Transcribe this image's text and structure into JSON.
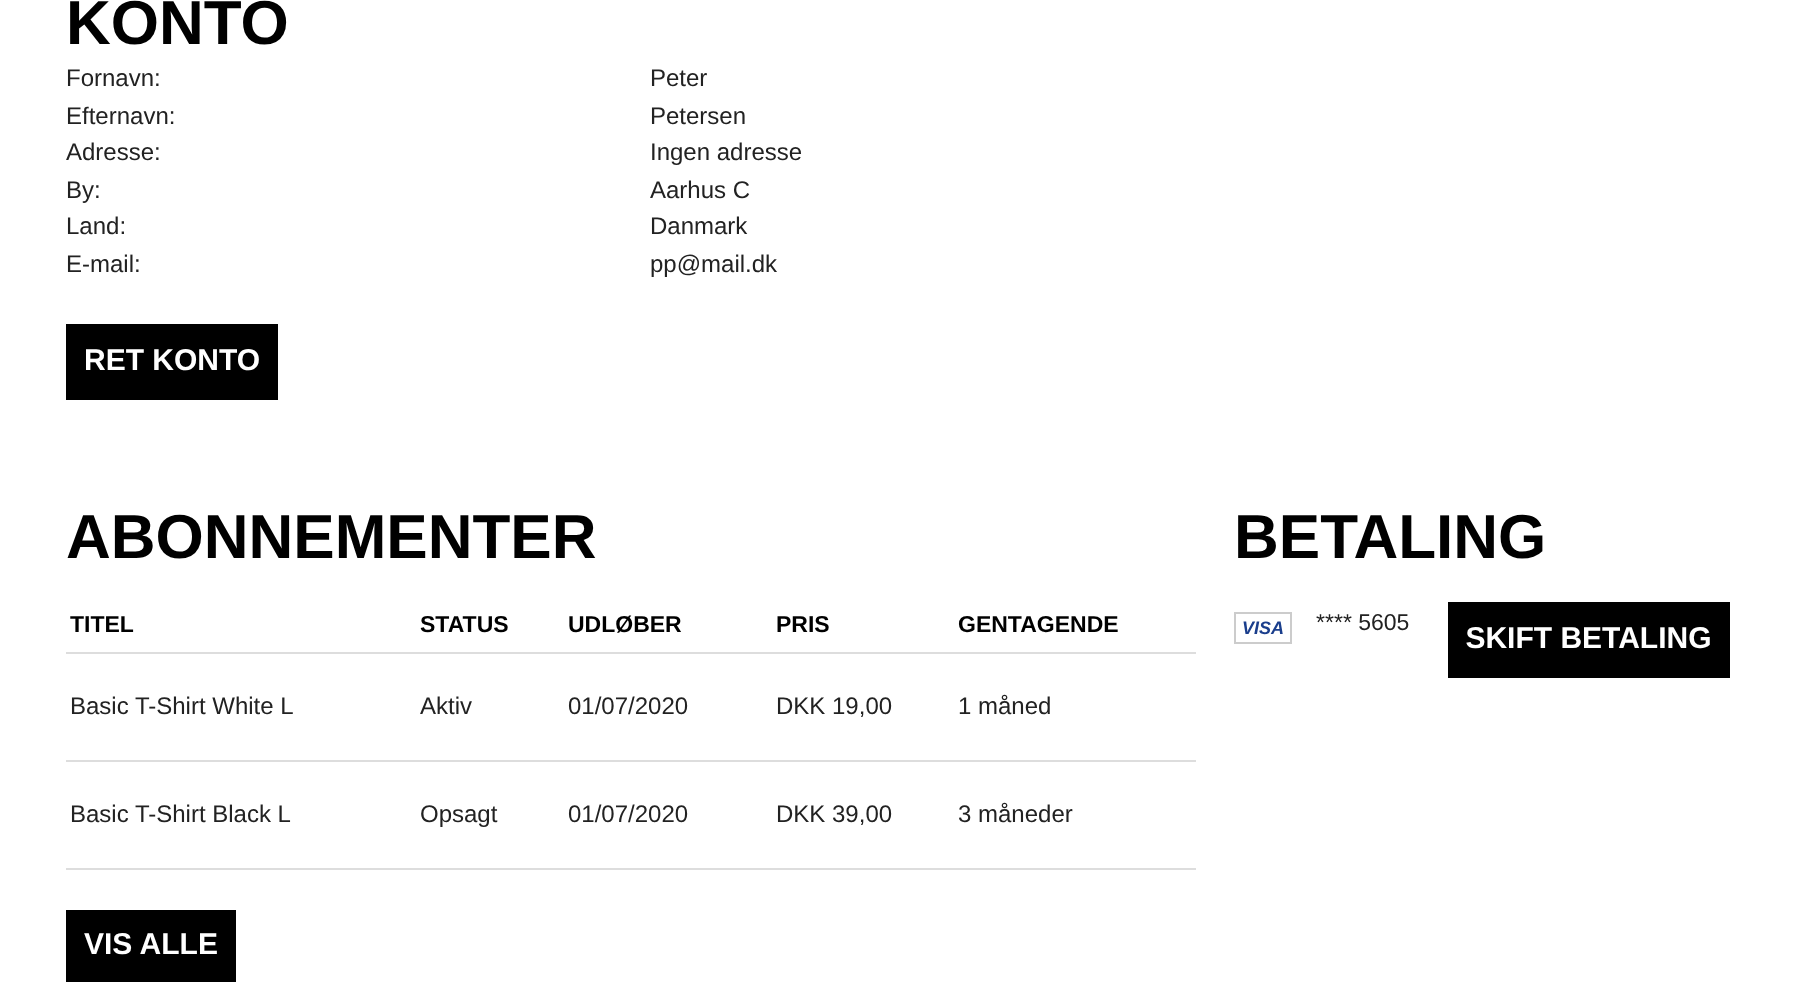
{
  "account": {
    "title": "KONTO",
    "fields": [
      {
        "label": "Fornavn:",
        "value": "Peter"
      },
      {
        "label": "Efternavn:",
        "value": "Petersen"
      },
      {
        "label": "Adresse:",
        "value": "Ingen adresse"
      },
      {
        "label": "By:",
        "value": "Aarhus C"
      },
      {
        "label": "Land:",
        "value": "Danmark"
      },
      {
        "label": "E-mail:",
        "value": "pp@mail.dk"
      }
    ],
    "button": "RET KONTO"
  },
  "subscriptions": {
    "title": "ABONNEMENTER",
    "columns": [
      "TITEL",
      "STATUS",
      "UDLØBER",
      "PRIS",
      "GENTAGENDE"
    ],
    "rows": [
      [
        "Basic T-Shirt White L",
        "Aktiv",
        "01/07/2020",
        "DKK 19,00",
        "1 måned"
      ],
      [
        "Basic T-Shirt Black L",
        "Opsagt",
        "01/07/2020",
        "DKK 39,00",
        "3 måneder"
      ]
    ],
    "button": "VIS ALLE"
  },
  "payment": {
    "title": "BETALING",
    "card_brand": "VISA",
    "card_number": "**** 5605",
    "button": "SKIFT BETALING"
  }
}
